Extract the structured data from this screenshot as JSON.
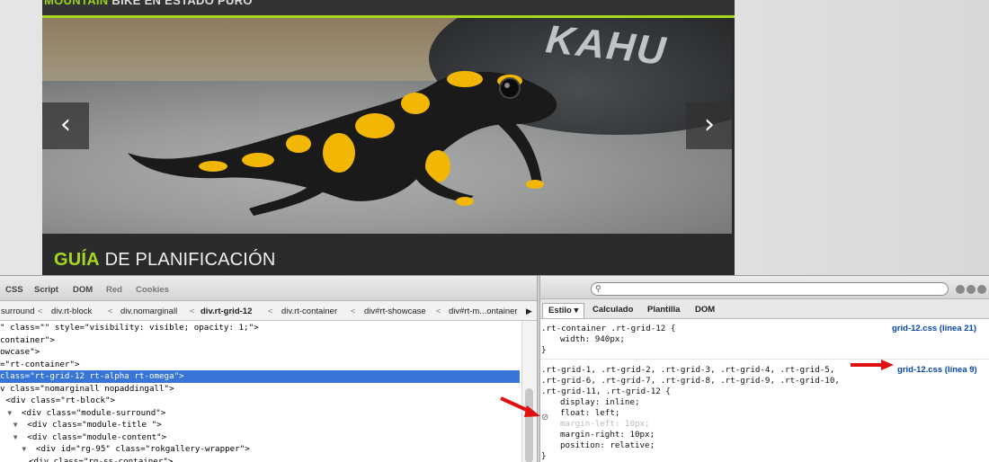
{
  "site": {
    "header_accent": "MOUNTAIN",
    "header_text": " BIKE EN ESTADO PURO",
    "tire_text": "KAHU",
    "prev_glyph": "‹",
    "next_glyph": "›",
    "heading_accent": "GUÍA",
    "heading_text": " DE PLANIFICACIÓN"
  },
  "toolbar": {
    "tabs": [
      "CSS",
      "Script",
      "DOM",
      "Red",
      "Cookies"
    ]
  },
  "breadcrumbs": [
    "surround",
    "div.rt-block",
    "div.nomarginall",
    "div.rt-grid-12",
    "div.rt-container",
    "div#rt-showcase",
    "div#rt-m...ontainer"
  ],
  "html_lines": [
    {
      "indent": "",
      "tri": "",
      "pre": "\" class=\"\" style=\"visibility: visible; opacity: 1;\">",
      "sel": false
    },
    {
      "indent": "",
      "tri": "",
      "pre": "container\">",
      "sel": false
    },
    {
      "indent": "",
      "tri": "",
      "pre": "owcase\">",
      "sel": false
    },
    {
      "indent": "",
      "tri": "",
      "pre": "=\"rt-container\">",
      "sel": false
    },
    {
      "indent": "",
      "tri": "",
      "pre": "class=\"rt-grid-12 rt-alpha rt-omega\">",
      "sel": true
    },
    {
      "indent": "",
      "tri": "",
      "pre": "v class=\"nomarginall nopaddingall\">",
      "sel": false
    },
    {
      "indent": "  ",
      "tri": "",
      "pre": "<div class=\"rt-block\">",
      "sel": false
    },
    {
      "indent": "  ",
      "tri": "▼",
      "pre": " <div class=\"module-surround\">",
      "sel": false
    },
    {
      "indent": "    ",
      "tri": "▼",
      "pre": " <div class=\"module-title \">",
      "sel": false
    },
    {
      "indent": "    ",
      "tri": "▼",
      "pre": " <div class=\"module-content\">",
      "sel": false
    },
    {
      "indent": "       ",
      "tri": "▼",
      "pre": " <div id=\"rg-95\" class=\"rokgallery-wrapper\">",
      "sel": false
    },
    {
      "indent": "          ",
      "tri": "",
      "pre": "<div class=\"rg-ss-container\">",
      "sel": false
    }
  ],
  "side_tabs": [
    "Estilo ▾",
    "Calculado",
    "Plantilla",
    "DOM"
  ],
  "css_rules": {
    "rule1_selector": ".rt-container .rt-grid-12 {",
    "rule1_props": [
      "width: 940px;"
    ],
    "rule1_close": "}",
    "rule1_source": "grid-12.css (línea 21)",
    "rule2_selector": [
      ".rt-grid-1, .rt-grid-2, .rt-grid-3, .rt-grid-4, .rt-grid-5,",
      ".rt-grid-6, .rt-grid-7, .rt-grid-8, .rt-grid-9, .rt-grid-10,",
      ".rt-grid-11, .rt-grid-12 {"
    ],
    "rule2_props": [
      "display: inline;",
      "float: left;",
      "margin-left: 10px;",
      "margin-right: 10px;",
      "position: relative;"
    ],
    "rule2_close": "}",
    "rule2_source": "grid-12.css (línea 9)"
  },
  "colors": {
    "accent_green": "#a6d81f",
    "selection_blue": "#3875d7",
    "annotation_red": "#e01010",
    "link_blue": "#0645ad"
  },
  "icons": {
    "search": "search-icon",
    "disabled": "disabled-rule-icon"
  }
}
